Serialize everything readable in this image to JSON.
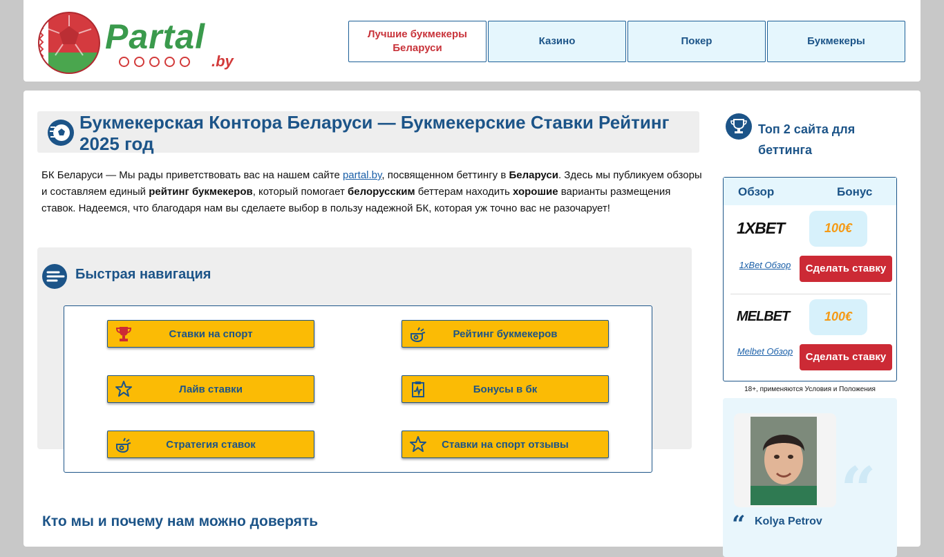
{
  "header": {
    "logo_text": "Partal",
    "logo_suffix": ".by",
    "nav": [
      {
        "label": "Лучшие букмекеры Беларуси",
        "active": true
      },
      {
        "label": "Казино",
        "active": false
      },
      {
        "label": "Покер",
        "active": false
      },
      {
        "label": "Букмекеры",
        "active": false
      }
    ]
  },
  "main": {
    "title": "Букмекерская Контора Беларуси — Букмекерские Ставки Рейтинг 2025 год",
    "intro": {
      "p1": "БК Беларуси — Мы рады приветствовать вас на нашем сайте ",
      "link": "partal.by",
      "p2": ", посвященном беттингу в ",
      "b1": "Беларуси",
      "p3": ". Здесь мы публикуем обзоры и составляем единый ",
      "b2": "рейтинг букмекеров",
      "p4": ", который помогает ",
      "b3": "белорусским",
      "p5": " беттерам находить ",
      "b4": "хорошие",
      "p6": " варианты размещения ставок. Надеемся, что благодаря нам вы сделаете выбор в пользу надежной БК, которая уж точно вас не разочарует!"
    },
    "quick_nav": {
      "title": "Быстрая навигация",
      "items": [
        {
          "label": "Ставки на спорт",
          "icon": "trophy-icon"
        },
        {
          "label": "Рейтинг букмекеров",
          "icon": "whistle-icon"
        },
        {
          "label": "Лайв ставки",
          "icon": "star-icon"
        },
        {
          "label": "Бонусы в бк",
          "icon": "clipboard-icon"
        },
        {
          "label": "Стратегия ставок",
          "icon": "whistle-icon"
        },
        {
          "label": "Ставки на спорт отзывы",
          "icon": "star-icon"
        }
      ]
    },
    "section2_title": "Кто мы и почему нам можно доверять"
  },
  "sidebar": {
    "title": "Топ 2 сайта для беттинга",
    "table_head": {
      "review": "Обзор",
      "bonus": "Бонус"
    },
    "rows": [
      {
        "brand": "1XBET",
        "bonus": "100€",
        "review_link": "1xBet Обзор",
        "cta": "Сделать ставку"
      },
      {
        "brand": "MELBET",
        "bonus": "100€",
        "review_link": "Melbet Обзор",
        "cta": "Сделать ставку"
      }
    ],
    "disclaimer": "18+, применяются Условия и Положения",
    "author": {
      "name": "Kolya Petrov"
    }
  },
  "colors": {
    "brand_blue": "#1c5488",
    "accent_yellow": "#fbbb05",
    "cta_red": "#cc2a35",
    "light_blue": "#e5f6fd"
  }
}
